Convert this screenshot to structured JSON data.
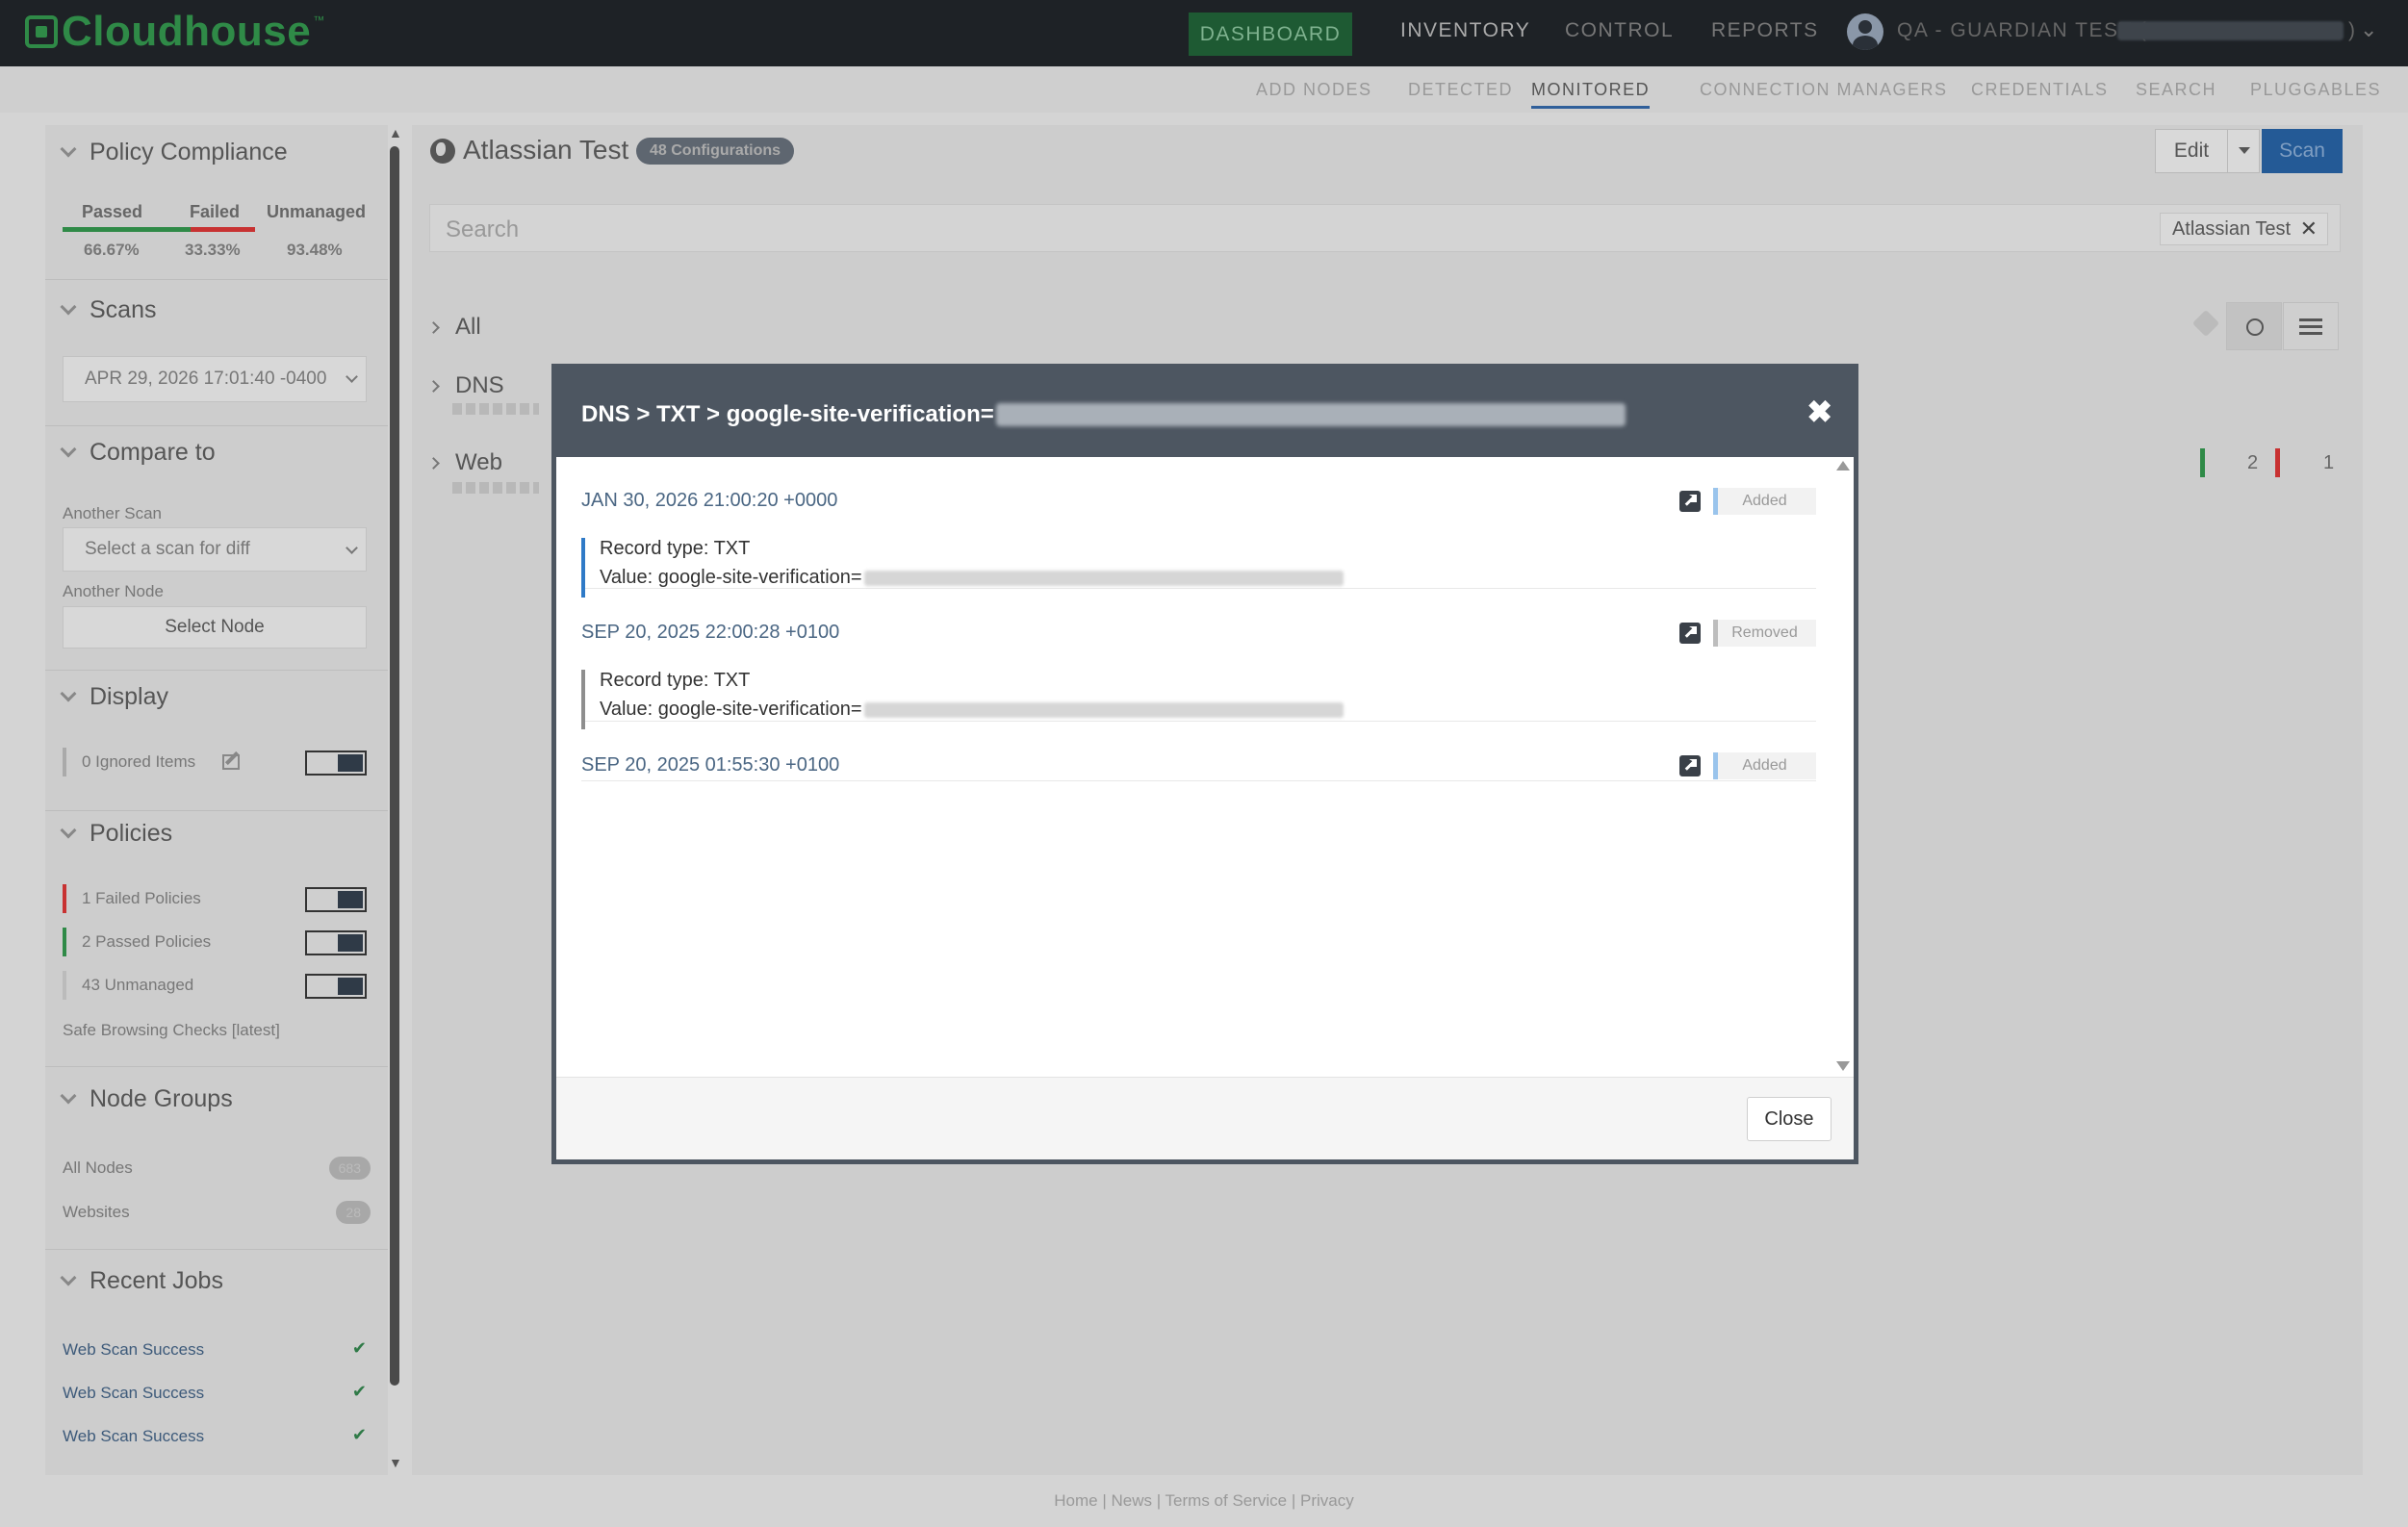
{
  "app": {
    "logo_text": "Cloudhouse",
    "logo_tm": "™",
    "nav": {
      "dashboard": "DASHBOARD",
      "inventory": "INVENTORY",
      "control": "CONTROL",
      "reports": "REPORTS"
    },
    "user": {
      "name": "QA - GUARDIAN TEST (",
      "close_paren": ")"
    }
  },
  "subnav": {
    "add_nodes": "ADD NODES",
    "detected": "DETECTED",
    "monitored": "MONITORED",
    "connection_managers": "CONNECTION MANAGERS",
    "credentials": "CREDENTIALS",
    "search": "SEARCH",
    "pluggables": "PLUGGABLES"
  },
  "sidebar": {
    "policy_compliance": {
      "title": "Policy Compliance",
      "passed_label": "Passed",
      "failed_label": "Failed",
      "unmanaged_label": "Unmanaged",
      "passed_value": "66.67%",
      "failed_value": "33.33%",
      "unmanaged_value": "93.48%",
      "passed_fraction": 0.6667,
      "failed_fraction": 0.3333
    },
    "scans": {
      "title": "Scans",
      "selected": "APR 29, 2026 17:01:40 -0400"
    },
    "compare": {
      "title": "Compare to",
      "another_scan_label": "Another Scan",
      "scan_placeholder": "Select a scan for diff",
      "another_node_label": "Another Node",
      "select_node": "Select Node"
    },
    "display": {
      "title": "Display",
      "ignored_items": "0 Ignored Items"
    },
    "policies": {
      "title": "Policies",
      "failed": "1 Failed Policies",
      "passed": "2 Passed Policies",
      "unmanaged": "43 Unmanaged",
      "safe_browsing": "Safe Browsing Checks [latest]"
    },
    "node_groups": {
      "title": "Node Groups",
      "all_nodes": "All Nodes",
      "all_nodes_count": "683",
      "websites": "Websites",
      "websites_count": "28"
    },
    "recent_jobs": {
      "title": "Recent Jobs",
      "items": [
        "Web Scan Success",
        "Web Scan Success",
        "Web Scan Success"
      ],
      "check": "✔"
    }
  },
  "main": {
    "title": "Atlassian Test",
    "config_badge": "48 Configurations",
    "edit": "Edit",
    "scan": "Scan",
    "search_placeholder": "Search",
    "search_chip": "Atlassian Test",
    "tree": {
      "all": "All",
      "dns": "DNS",
      "web": "Web"
    },
    "web_counts": {
      "failed": "2",
      "other": "1"
    }
  },
  "modal": {
    "title_prefix": "DNS > TXT > google-site-verification=",
    "close_x": "✖",
    "entries": [
      {
        "date": "JAN 30, 2026 21:00:20 +0000",
        "status": "Added",
        "record_type": "Record type: TXT",
        "value_prefix": "Value: google-site-verification="
      },
      {
        "date": "SEP 20, 2025 22:00:28 +0100",
        "status": "Removed",
        "record_type": "Record type: TXT",
        "value_prefix": "Value: google-site-verification="
      },
      {
        "date": "SEP 20, 2025 01:55:30 +0100",
        "status": "Added"
      }
    ],
    "close_button": "Close"
  },
  "footer": {
    "text": "Home | News | Terms of Service | Privacy"
  },
  "colors": {
    "added": "#9ac4ec",
    "removed": "#bdbdbd",
    "passed": "#2f8a47",
    "failed": "#c83232",
    "primary": "#245a96"
  }
}
